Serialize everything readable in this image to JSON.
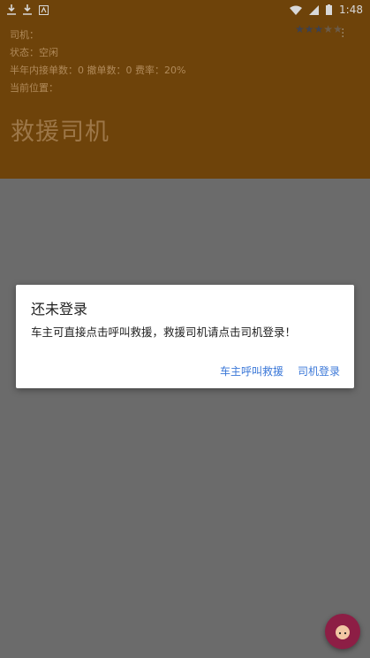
{
  "status_bar": {
    "time": "1:48"
  },
  "header": {
    "driver_label": "司机：",
    "status_line": "状态：空闲",
    "stats_line": "半年内接单数：0  撤单数：0  费率：20%",
    "location_line": "当前位置：",
    "title": "救援司机",
    "rating": {
      "stars_total": 5,
      "stars_filled": 3
    }
  },
  "dialog": {
    "title": "还未登录",
    "message": "车主可直接点击呼叫救援，救援司机请点击司机登录！",
    "owner_button": "车主呼叫救援",
    "driver_button": "司机登录"
  },
  "icons": {
    "fab": "avatar-face-icon",
    "overflow": "vertical-dots-icon"
  },
  "colors": {
    "header": "#6e430a",
    "dim_overlay": "#6b6b6b",
    "accent": "#3b78d8",
    "fab": "#8d1e45"
  }
}
